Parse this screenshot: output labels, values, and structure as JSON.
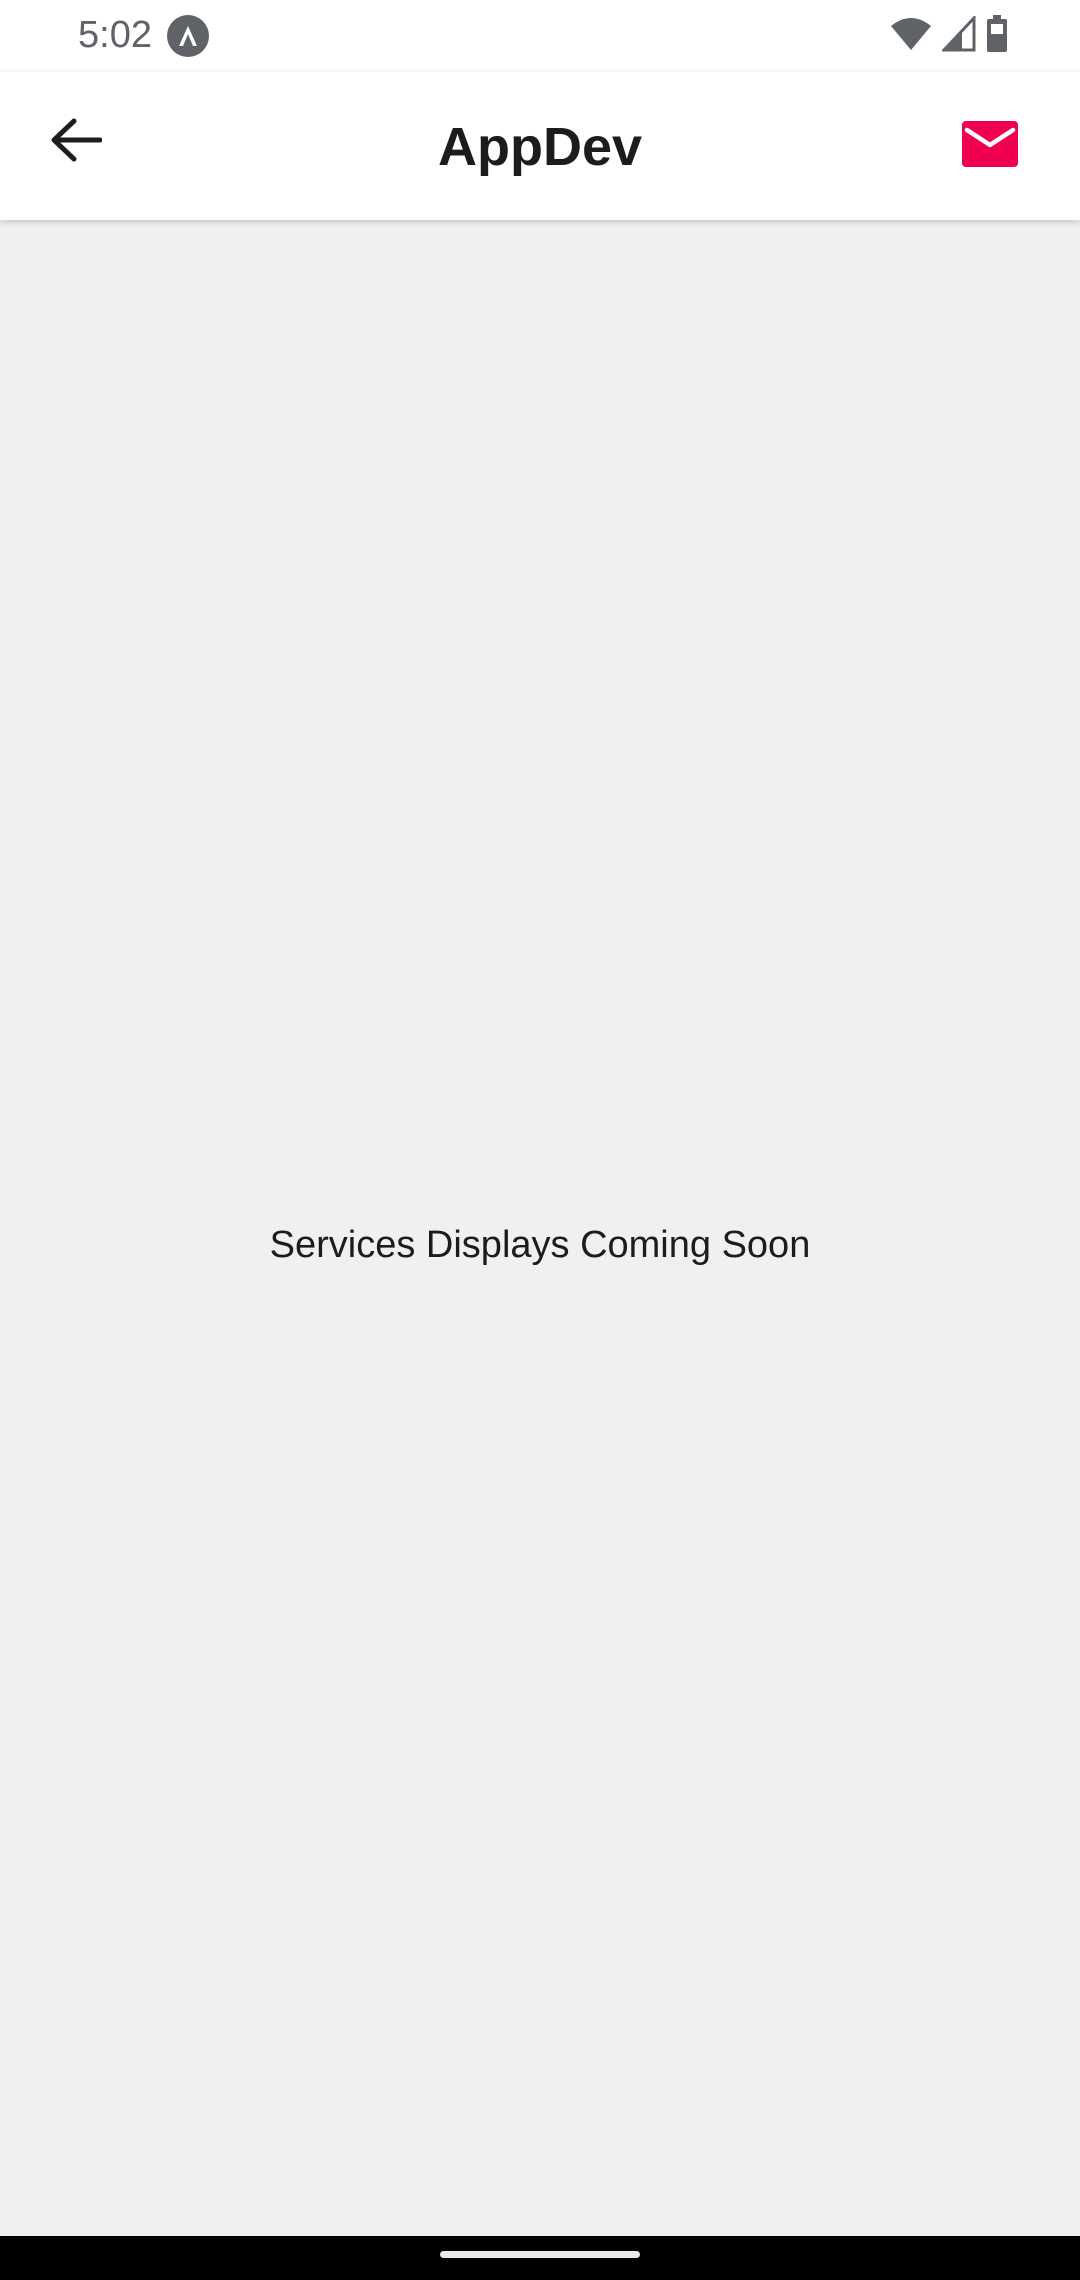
{
  "status_bar": {
    "time": "5:02",
    "app_icon": "app-notification-icon",
    "wifi_icon": "wifi-icon",
    "signal_icon": "signal-icon",
    "battery_icon": "battery-icon"
  },
  "app_bar": {
    "title": "AppDev",
    "back_icon": "arrow-back-icon",
    "mail_icon": "mail-icon",
    "accent_color": "#f0004f"
  },
  "main": {
    "message": "Services Displays Coming Soon"
  },
  "colors": {
    "background": "#f0f0f0",
    "app_bar_background": "#ffffff",
    "text": "#1c1c1c"
  }
}
